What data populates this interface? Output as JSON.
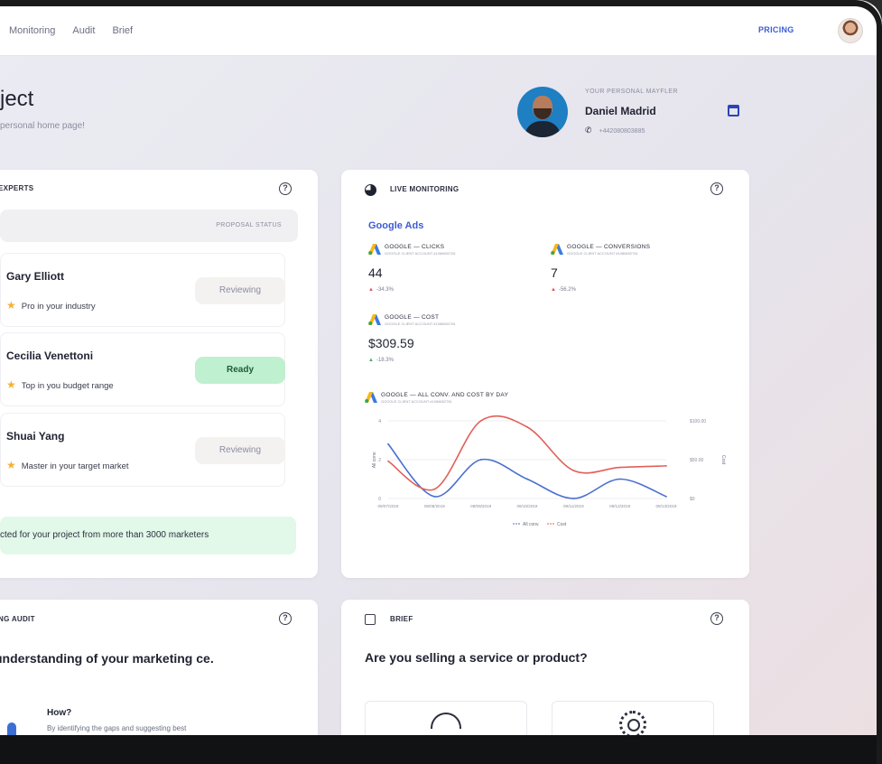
{
  "nav": {
    "links": [
      "Monitoring",
      "Audit",
      "Brief"
    ],
    "pricing": "PRICING"
  },
  "header": {
    "title": "ject",
    "subtitle": "personal home page!"
  },
  "mayfler": {
    "label": "YOUR PERSONAL MAYFLER",
    "name": "Daniel Madrid",
    "phone": "+442080803885"
  },
  "experts": {
    "title": "EXPERTS",
    "status_header": "PROPOSAL STATUS",
    "rows": [
      {
        "name": "Gary Elliott",
        "tag": "Pro in your industry",
        "status": "Reviewing"
      },
      {
        "name": "Cecilia Venettoni",
        "tag": "Top in you budget range",
        "status": "Ready"
      },
      {
        "name": "Shuai Yang",
        "tag": "Master in your target market",
        "status": "Reviewing"
      }
    ],
    "banner": "cted for your project from more than 3000 marketers"
  },
  "monitoring": {
    "title": "LIVE MONITORING",
    "section": "Google Ads",
    "metrics": [
      {
        "label": "GOOGLE — CLICKS",
        "sub": "GOOGLE CLIENT ACCOUNT #1086652781",
        "value": "44",
        "delta": "-34.3%"
      },
      {
        "label": "GOOGLE — CONVERSIONS",
        "sub": "GOOGLE CLIENT ACCOUNT #1086652781",
        "value": "7",
        "delta": "-56.2%"
      },
      {
        "label": "GOOGLE — COST",
        "sub": "GOOGLE CLIENT ACCOUNT #1086652781",
        "value": "$309.59",
        "delta": "-18.3%"
      }
    ],
    "chart_label": "GOOGLE — ALL CONV. AND COST BY DAY",
    "chart_sub": "GOOGLE CLIENT ACCOUNT #1086652781"
  },
  "chart_data": {
    "type": "line",
    "x": [
      "09/07/2019",
      "09/08/2019",
      "09/09/2019",
      "09/10/2019",
      "09/11/2019",
      "09/12/2019",
      "09/13/2019"
    ],
    "series": [
      {
        "name": "All conv.",
        "color": "#4a6fd1",
        "values": [
          2.8,
          0.1,
          2.0,
          1.0,
          0.0,
          1.0,
          0.1
        ],
        "axis": "left"
      },
      {
        "name": "Cost",
        "color": "#e0605a",
        "values": [
          48,
          12,
          100,
          92,
          36,
          40,
          42
        ],
        "axis": "right"
      }
    ],
    "ylabel": "All conv.",
    "y2label": "Cost",
    "yticks": [
      "0",
      "2",
      "4"
    ],
    "y2ticks": [
      "$0",
      "$50.00",
      "$100.00"
    ],
    "ylim": [
      0,
      4
    ],
    "y2lim": [
      0,
      100
    ]
  },
  "audit": {
    "title": "NG AUDIT",
    "heading": "understanding of your marketing ce.",
    "how": "How?",
    "how_desc": "By identifying the gaps and suggesting best"
  },
  "brief": {
    "title": "BRIEF",
    "question": "Are you selling a service or product?"
  },
  "icons": {
    "help": "?",
    "phone": "✆",
    "star": "★"
  }
}
